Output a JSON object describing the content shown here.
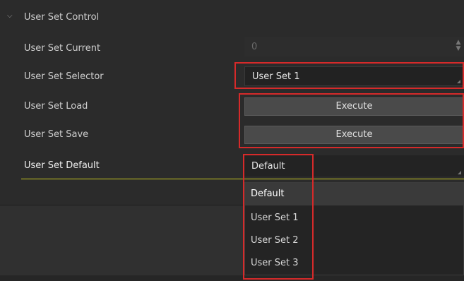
{
  "section": {
    "title": "User Set Control"
  },
  "rows": {
    "current": {
      "label": "User Set Current",
      "value": "0"
    },
    "selector": {
      "label": "User Set Selector",
      "value": "User Set 1"
    },
    "load": {
      "label": "User Set Load",
      "button": "Execute"
    },
    "save": {
      "label": "User Set Save",
      "button": "Execute"
    },
    "default": {
      "label": "User Set Default",
      "value": "Default"
    }
  },
  "dropdown": {
    "options": [
      "Default",
      "User Set 1",
      "User Set 2",
      "User Set 3"
    ],
    "selected": "Default"
  },
  "colors": {
    "highlight": "#d62a2a",
    "active_underline": "#c8c821",
    "background": "#2b2b2b"
  },
  "icons": {
    "section_toggle": "chevron-down-icon",
    "spinner": "spin-arrows-icon",
    "select_corner": "dropdown-corner-icon"
  }
}
